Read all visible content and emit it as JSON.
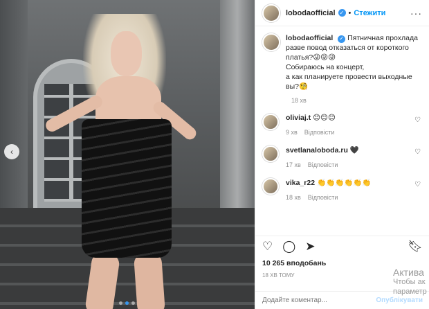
{
  "header": {
    "username": "lobodaofficial",
    "separator": "•",
    "follow_label": "Стежити",
    "more_icon": "more-horizontal-icon"
  },
  "caption": {
    "username": "lobodaofficial",
    "line1": "Пятничная прохлада",
    "line2": "разве повод отказаться от короткого",
    "line3": "платья?😜😜😜",
    "line4": "Собираюсь на концерт,",
    "line5": "а как планируете провести выходные",
    "line6": "вы?🧐",
    "time": "18 хв"
  },
  "comments": [
    {
      "username": "oliviaj.t",
      "text": "😊😊😊",
      "time": "9 хв",
      "reply": "Відповісти"
    },
    {
      "username": "svetlanaloboda.ru",
      "text": "🖤",
      "time": "17 хв",
      "reply": "Відповісти"
    },
    {
      "username": "vika_r22",
      "text": "👏👏👏👏👏👏",
      "time": "18 хв",
      "reply": "Відповісти"
    }
  ],
  "actions": {
    "like_icon": "heart-icon",
    "comment_icon": "comment-icon",
    "share_icon": "share-icon",
    "save_icon": "bookmark-icon"
  },
  "likes": "10 265 вподобань",
  "time_ago": "18 хв тому",
  "add_comment": {
    "placeholder": "Додайте коментар...",
    "publish_label": "Опублікувати"
  },
  "watermark": {
    "line1": "Актива",
    "line2": "Чтобы ак",
    "line3": "параметр"
  },
  "carousel": {
    "slides": 3,
    "active": 1
  }
}
